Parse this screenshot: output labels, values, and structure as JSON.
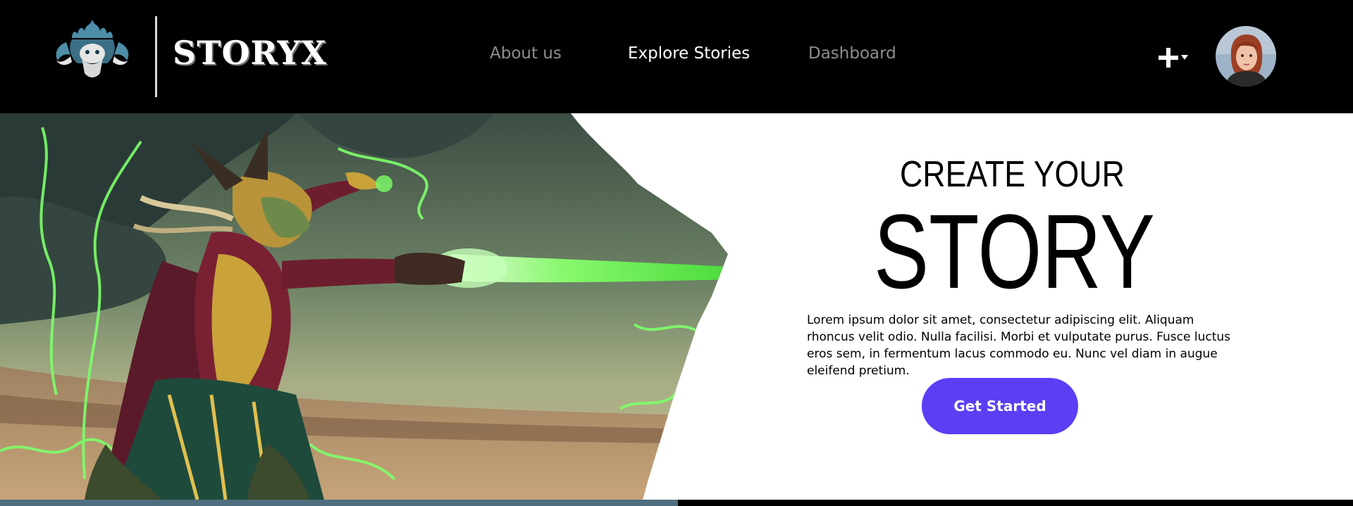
{
  "brand": {
    "name": "STORYX",
    "logo_icon": "horned-warrior-emblem"
  },
  "nav": {
    "items": [
      {
        "label": "About us",
        "state": "inactive"
      },
      {
        "label": "Explore Stories",
        "state": "active"
      },
      {
        "label": "Dashboard",
        "state": "inactive"
      }
    ]
  },
  "header_actions": {
    "add_icon": "plus-icon",
    "dropdown_icon": "caret-down-icon",
    "avatar_icon": "user-avatar"
  },
  "hero": {
    "eyebrow": "CREATE YOUR",
    "title": "STORY",
    "body": "Lorem ipsum dolor sit amet, consectetur adipiscing elit. Aliquam rhoncus velit odio. Nulla facilisi. Morbi et vulputate purus. Fusce luctus eros sem, in fermentum lacus commodo eu. Nunc vel diam in augue eleifend pretium.",
    "cta_label": "Get Started",
    "illustration": "sorcerer-casting-green-energy"
  },
  "colors": {
    "header_bg": "#000000",
    "nav_active": "#ffffff",
    "nav_inactive": "#8e8e8e",
    "cta": "#5a3ff5",
    "accent_green": "#7dff6a"
  }
}
